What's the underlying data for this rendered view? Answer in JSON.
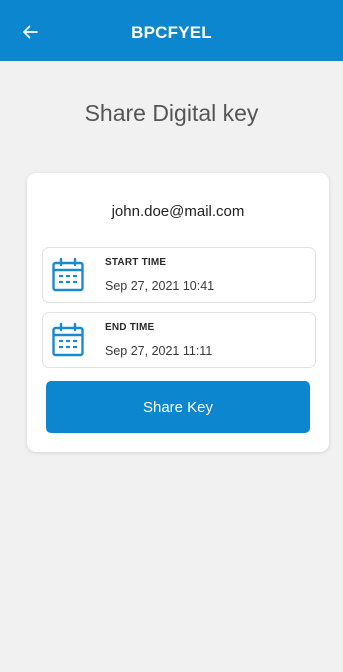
{
  "app_bar": {
    "title": "BPCFYEL",
    "back_icon": "arrow-left-icon",
    "background_color": "#0b86cf"
  },
  "page": {
    "title": "Share Digital key"
  },
  "card": {
    "email": "john.doe@mail.com",
    "start_time": {
      "label": "START TIME",
      "value": "Sep 27, 2021 10:41",
      "icon": "calendar-icon"
    },
    "end_time": {
      "label": "END TIME",
      "value": "Sep 27, 2021 11:11",
      "icon": "calendar-icon"
    },
    "share_button": {
      "label": "Share Key",
      "color": "#0b86cf"
    }
  }
}
